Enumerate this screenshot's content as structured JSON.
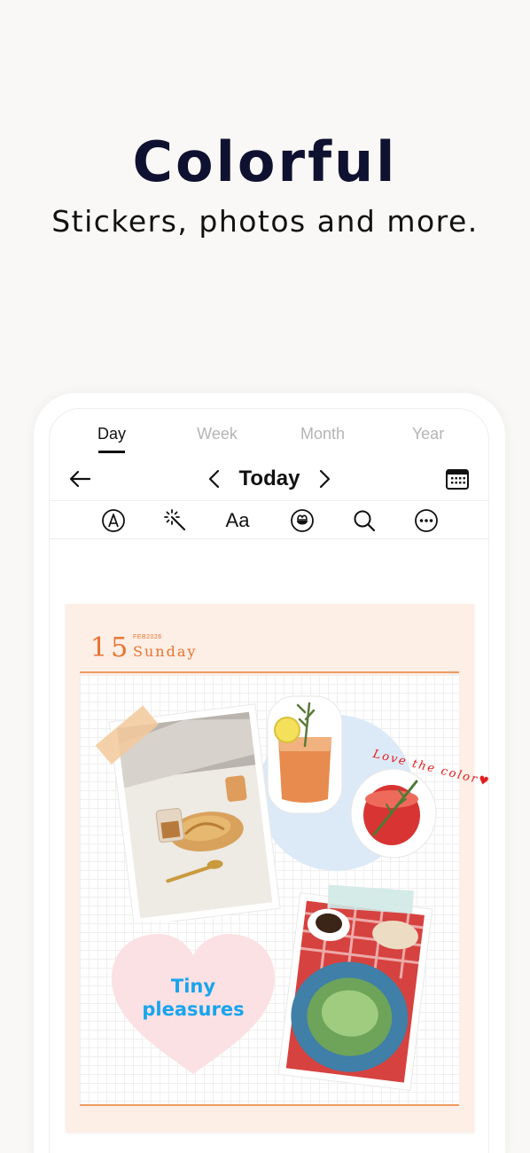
{
  "headline": "Colorful",
  "subline": "Stickers, photos and more.",
  "tabs": [
    {
      "label": "Day",
      "active": true
    },
    {
      "label": "Week",
      "active": false
    },
    {
      "label": "Month",
      "active": false
    },
    {
      "label": "Year",
      "active": false
    }
  ],
  "nav": {
    "title": "Today"
  },
  "toolbar": {
    "text_tool_label": "Aa",
    "icons": [
      "pen-icon",
      "magic-wand-icon",
      "text-icon",
      "sticker-icon",
      "search-icon",
      "more-icon"
    ]
  },
  "journal": {
    "day_number": "15",
    "month_year": "FEB2026",
    "weekday": "Sunday",
    "handwritten_note": "Love the color♥",
    "heart_text_line1": "Tiny",
    "heart_text_line2": "pleasures"
  },
  "colors": {
    "accent_orange": "#e9722d",
    "heart_pink": "#fbe1e3",
    "circle_blue": "#dce9f7",
    "heart_text_blue": "#19a4ee",
    "page_bg": "#fdeee6"
  }
}
